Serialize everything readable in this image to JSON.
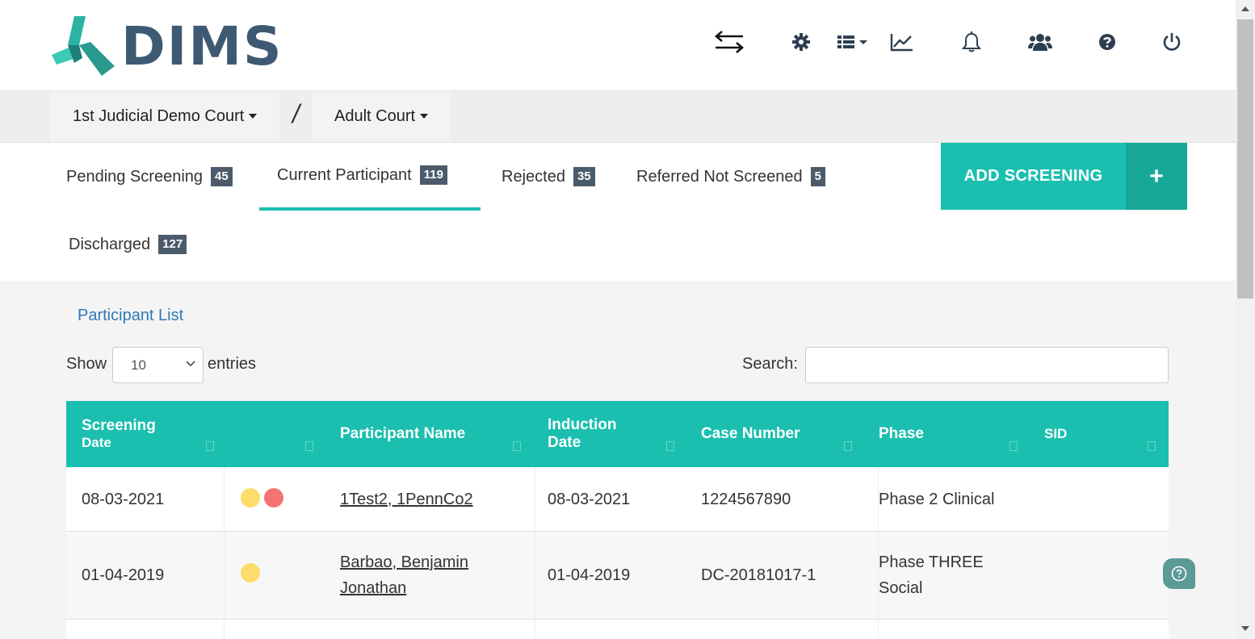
{
  "app": {
    "logo_text": "DIMS",
    "brand_colors": {
      "teal": "#1abfaf",
      "logo_blue": "#3e5a73",
      "badge": "#4b5b6b",
      "link_blue": "#2f78b8"
    }
  },
  "header": {
    "icons": [
      "switch-arrows-icon",
      "gear-icon",
      "list-menu-icon",
      "line-chart-icon",
      "bell-icon",
      "users-icon",
      "help-icon",
      "power-icon"
    ]
  },
  "courtbar": {
    "court": "1st Judicial Demo Court",
    "separator": "/",
    "program": "Adult Court"
  },
  "tabs": {
    "items": [
      {
        "label": "Pending Screening",
        "count": "45"
      },
      {
        "label": "Current Participant",
        "count": "119",
        "active": true
      },
      {
        "label": "Rejected",
        "count": "35"
      },
      {
        "label": "Referred Not Screened",
        "count": "5"
      },
      {
        "label": "Discharged",
        "count": "127"
      }
    ],
    "add_button": {
      "label": "ADD SCREENING",
      "icon": "+"
    }
  },
  "list": {
    "title": "Participant List",
    "show_label": "Show",
    "page_size": "10",
    "entries_label": "entries",
    "search_label": "Search:",
    "search_value": ""
  },
  "table": {
    "columns": [
      {
        "line1": "Screening",
        "line2": "Date"
      },
      {
        "line1": "",
        "line2": ""
      },
      {
        "line1": "Participant Name",
        "line2": ""
      },
      {
        "line1": "Induction",
        "line2": "Date"
      },
      {
        "line1": "Case Number",
        "line2": ""
      },
      {
        "line1": "Phase",
        "line2": ""
      },
      {
        "line1": "SID",
        "line2": ""
      }
    ],
    "rows": [
      {
        "screening_date": "08-03-2021",
        "status_dots": [
          "yellow",
          "red"
        ],
        "name_line1": "1Test2, 1PennCo2",
        "name_line2": "",
        "induction_date": "08-03-2021",
        "case_number": "1224567890",
        "phase_line1": "Phase 2 Clinical",
        "phase_line2": "",
        "sid": ""
      },
      {
        "screening_date": "01-04-2019",
        "status_dots": [
          "yellow"
        ],
        "name_line1": "Barbao, Benjamin",
        "name_line2": "Jonathan",
        "induction_date": "01-04-2019",
        "case_number": "DC-20181017-1",
        "phase_line1": "Phase THREE",
        "phase_line2": "Social",
        "sid": ""
      }
    ]
  }
}
